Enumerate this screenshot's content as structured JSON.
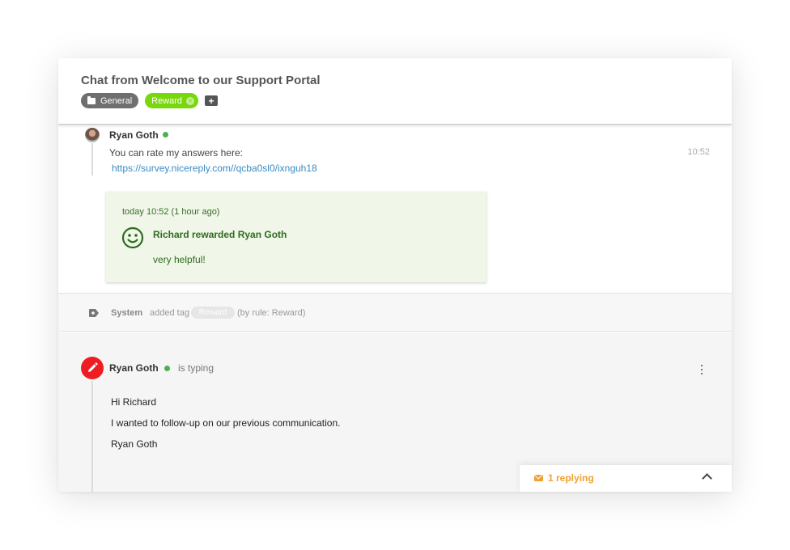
{
  "header": {
    "title": "Chat from Welcome to our Support Portal",
    "tags": [
      {
        "label": "General",
        "icon": "folder-icon",
        "color": "#6f6f6f"
      },
      {
        "label": "Reward",
        "icon": "close-icon",
        "color": "#78d80c"
      }
    ],
    "add_tag_icon": "plus-icon"
  },
  "message": {
    "author": "Ryan Goth",
    "online": true,
    "text": "You can rate my answers here:",
    "link": "https://survey.nicereply.com//qcba0sl0/ixnguh18",
    "time": "10:52"
  },
  "reward": {
    "when": "today 10:52 (1 hour ago)",
    "title": "Richard rewarded Ryan Goth",
    "note": "very helpful!",
    "color": "#2e6b1f",
    "background": "#f0f6e8"
  },
  "system_event": {
    "actor": "System",
    "action": "added tag",
    "tag": "Reward",
    "rule": "(by rule: Reward)"
  },
  "composer": {
    "author": "Ryan Goth",
    "status": "is typing",
    "draft": [
      "Hi Richard",
      "I wanted to follow-up on our previous communication.",
      "Ryan Goth"
    ],
    "accent": "#ee1d23"
  },
  "replying": {
    "label": "1 replying",
    "color": "#f0a030"
  }
}
